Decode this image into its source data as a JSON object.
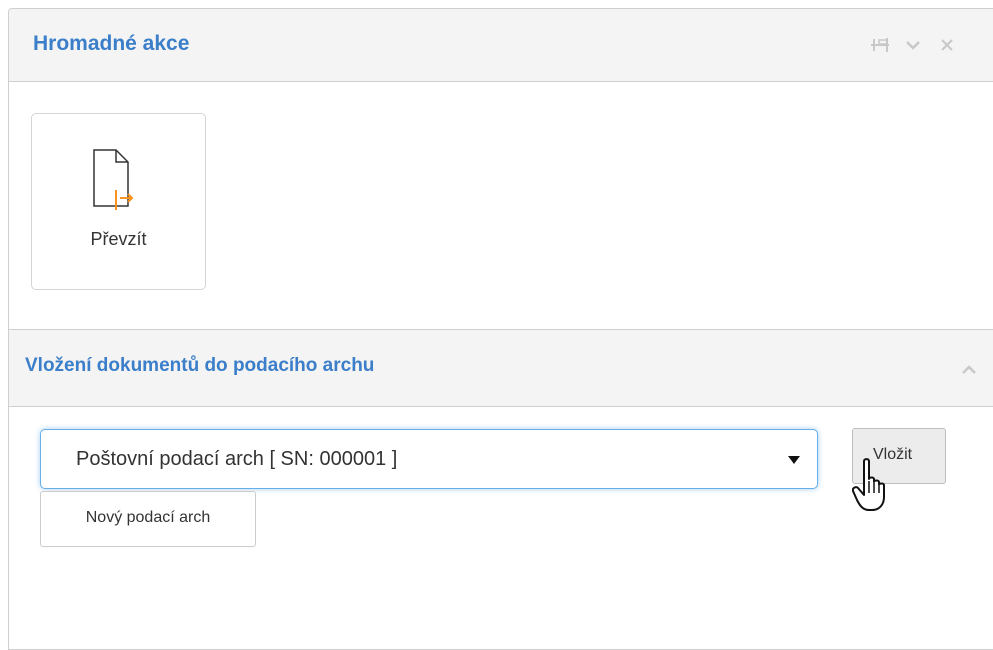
{
  "panel": {
    "title": "Hromadné akce",
    "tools": [
      "pin-icon",
      "chevron-down-icon",
      "close-icon"
    ]
  },
  "actions": [
    {
      "label": "Převzít",
      "icon": "document-take-icon",
      "accent": "#f7931e"
    }
  ],
  "section": {
    "title": "Vložení dokumentů do podacího archu",
    "collapse_icon": "chevron-up-icon"
  },
  "form": {
    "select_value": "Poštovní podací arch [ SN: 000001 ]",
    "insert_label": "Vložit",
    "new_label": "Nový podací arch"
  },
  "colors": {
    "title": "#3b7ec9",
    "header_bg": "#f4f4f4",
    "focus": "#66afe9"
  }
}
